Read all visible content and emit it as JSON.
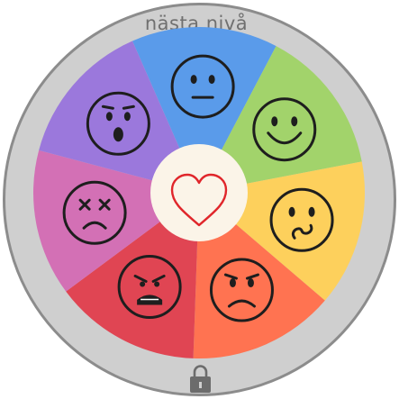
{
  "wheel": {
    "top_label": "nästa nivå",
    "lock_icon": "lock-icon",
    "center_icon": "heart-icon",
    "segments": [
      {
        "id": "neutral",
        "icon": "neutral-face-icon",
        "color": "#5a9bea"
      },
      {
        "id": "happy",
        "icon": "smiling-face-icon",
        "color": "#a2d36b"
      },
      {
        "id": "confused",
        "icon": "confused-face-icon",
        "color": "#fdd05c"
      },
      {
        "id": "sad",
        "icon": "frowning-face-icon",
        "color": "#ff7351"
      },
      {
        "id": "angry",
        "icon": "angry-face-icon",
        "color": "#e04553"
      },
      {
        "id": "dizzy",
        "icon": "dizzy-face-icon",
        "color": "#d370b5"
      },
      {
        "id": "surprised",
        "icon": "surprised-face-icon",
        "color": "#9b78dc"
      }
    ]
  }
}
